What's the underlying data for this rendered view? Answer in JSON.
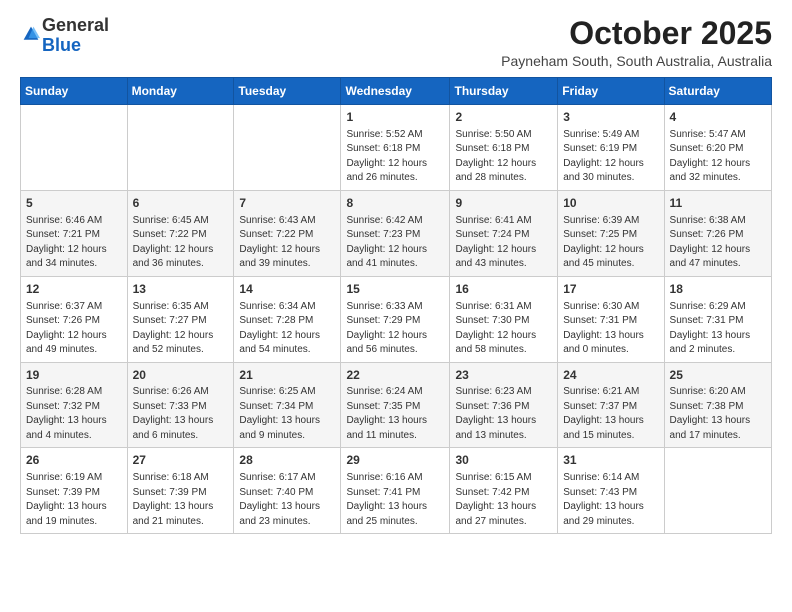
{
  "logo": {
    "general": "General",
    "blue": "Blue"
  },
  "title": "October 2025",
  "subtitle": "Payneham South, South Australia, Australia",
  "days_header": [
    "Sunday",
    "Monday",
    "Tuesday",
    "Wednesday",
    "Thursday",
    "Friday",
    "Saturday"
  ],
  "weeks": [
    [
      {
        "day": "",
        "info": ""
      },
      {
        "day": "",
        "info": ""
      },
      {
        "day": "",
        "info": ""
      },
      {
        "day": "1",
        "info": "Sunrise: 5:52 AM\nSunset: 6:18 PM\nDaylight: 12 hours\nand 26 minutes."
      },
      {
        "day": "2",
        "info": "Sunrise: 5:50 AM\nSunset: 6:18 PM\nDaylight: 12 hours\nand 28 minutes."
      },
      {
        "day": "3",
        "info": "Sunrise: 5:49 AM\nSunset: 6:19 PM\nDaylight: 12 hours\nand 30 minutes."
      },
      {
        "day": "4",
        "info": "Sunrise: 5:47 AM\nSunset: 6:20 PM\nDaylight: 12 hours\nand 32 minutes."
      }
    ],
    [
      {
        "day": "5",
        "info": "Sunrise: 6:46 AM\nSunset: 7:21 PM\nDaylight: 12 hours\nand 34 minutes."
      },
      {
        "day": "6",
        "info": "Sunrise: 6:45 AM\nSunset: 7:22 PM\nDaylight: 12 hours\nand 36 minutes."
      },
      {
        "day": "7",
        "info": "Sunrise: 6:43 AM\nSunset: 7:22 PM\nDaylight: 12 hours\nand 39 minutes."
      },
      {
        "day": "8",
        "info": "Sunrise: 6:42 AM\nSunset: 7:23 PM\nDaylight: 12 hours\nand 41 minutes."
      },
      {
        "day": "9",
        "info": "Sunrise: 6:41 AM\nSunset: 7:24 PM\nDaylight: 12 hours\nand 43 minutes."
      },
      {
        "day": "10",
        "info": "Sunrise: 6:39 AM\nSunset: 7:25 PM\nDaylight: 12 hours\nand 45 minutes."
      },
      {
        "day": "11",
        "info": "Sunrise: 6:38 AM\nSunset: 7:26 PM\nDaylight: 12 hours\nand 47 minutes."
      }
    ],
    [
      {
        "day": "12",
        "info": "Sunrise: 6:37 AM\nSunset: 7:26 PM\nDaylight: 12 hours\nand 49 minutes."
      },
      {
        "day": "13",
        "info": "Sunrise: 6:35 AM\nSunset: 7:27 PM\nDaylight: 12 hours\nand 52 minutes."
      },
      {
        "day": "14",
        "info": "Sunrise: 6:34 AM\nSunset: 7:28 PM\nDaylight: 12 hours\nand 54 minutes."
      },
      {
        "day": "15",
        "info": "Sunrise: 6:33 AM\nSunset: 7:29 PM\nDaylight: 12 hours\nand 56 minutes."
      },
      {
        "day": "16",
        "info": "Sunrise: 6:31 AM\nSunset: 7:30 PM\nDaylight: 12 hours\nand 58 minutes."
      },
      {
        "day": "17",
        "info": "Sunrise: 6:30 AM\nSunset: 7:31 PM\nDaylight: 13 hours\nand 0 minutes."
      },
      {
        "day": "18",
        "info": "Sunrise: 6:29 AM\nSunset: 7:31 PM\nDaylight: 13 hours\nand 2 minutes."
      }
    ],
    [
      {
        "day": "19",
        "info": "Sunrise: 6:28 AM\nSunset: 7:32 PM\nDaylight: 13 hours\nand 4 minutes."
      },
      {
        "day": "20",
        "info": "Sunrise: 6:26 AM\nSunset: 7:33 PM\nDaylight: 13 hours\nand 6 minutes."
      },
      {
        "day": "21",
        "info": "Sunrise: 6:25 AM\nSunset: 7:34 PM\nDaylight: 13 hours\nand 9 minutes."
      },
      {
        "day": "22",
        "info": "Sunrise: 6:24 AM\nSunset: 7:35 PM\nDaylight: 13 hours\nand 11 minutes."
      },
      {
        "day": "23",
        "info": "Sunrise: 6:23 AM\nSunset: 7:36 PM\nDaylight: 13 hours\nand 13 minutes."
      },
      {
        "day": "24",
        "info": "Sunrise: 6:21 AM\nSunset: 7:37 PM\nDaylight: 13 hours\nand 15 minutes."
      },
      {
        "day": "25",
        "info": "Sunrise: 6:20 AM\nSunset: 7:38 PM\nDaylight: 13 hours\nand 17 minutes."
      }
    ],
    [
      {
        "day": "26",
        "info": "Sunrise: 6:19 AM\nSunset: 7:39 PM\nDaylight: 13 hours\nand 19 minutes."
      },
      {
        "day": "27",
        "info": "Sunrise: 6:18 AM\nSunset: 7:39 PM\nDaylight: 13 hours\nand 21 minutes."
      },
      {
        "day": "28",
        "info": "Sunrise: 6:17 AM\nSunset: 7:40 PM\nDaylight: 13 hours\nand 23 minutes."
      },
      {
        "day": "29",
        "info": "Sunrise: 6:16 AM\nSunset: 7:41 PM\nDaylight: 13 hours\nand 25 minutes."
      },
      {
        "day": "30",
        "info": "Sunrise: 6:15 AM\nSunset: 7:42 PM\nDaylight: 13 hours\nand 27 minutes."
      },
      {
        "day": "31",
        "info": "Sunrise: 6:14 AM\nSunset: 7:43 PM\nDaylight: 13 hours\nand 29 minutes."
      },
      {
        "day": "",
        "info": ""
      }
    ]
  ]
}
